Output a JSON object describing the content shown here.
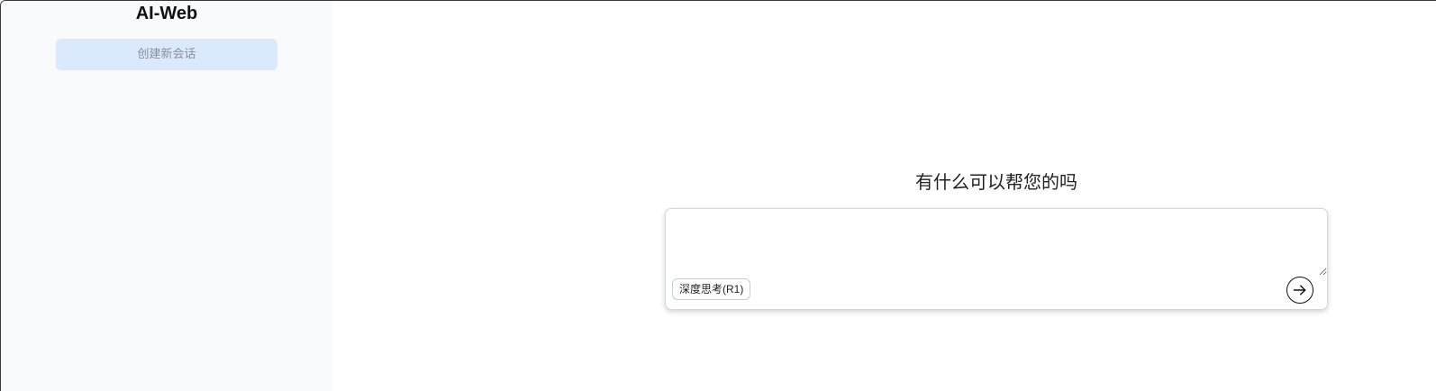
{
  "sidebar": {
    "title": "AI-Web",
    "new_chat_label": "创建新会话"
  },
  "main": {
    "greeting": "有什么可以帮您的吗",
    "composer": {
      "input_value": "",
      "placeholder": "",
      "deep_think_label": "深度思考(R1)",
      "send_icon": "arrow-right-icon"
    }
  },
  "colors": {
    "sidebar_bg": "#f9fafb",
    "new_chat_bg": "#dbe9fe",
    "new_chat_text": "#8a8f98"
  }
}
